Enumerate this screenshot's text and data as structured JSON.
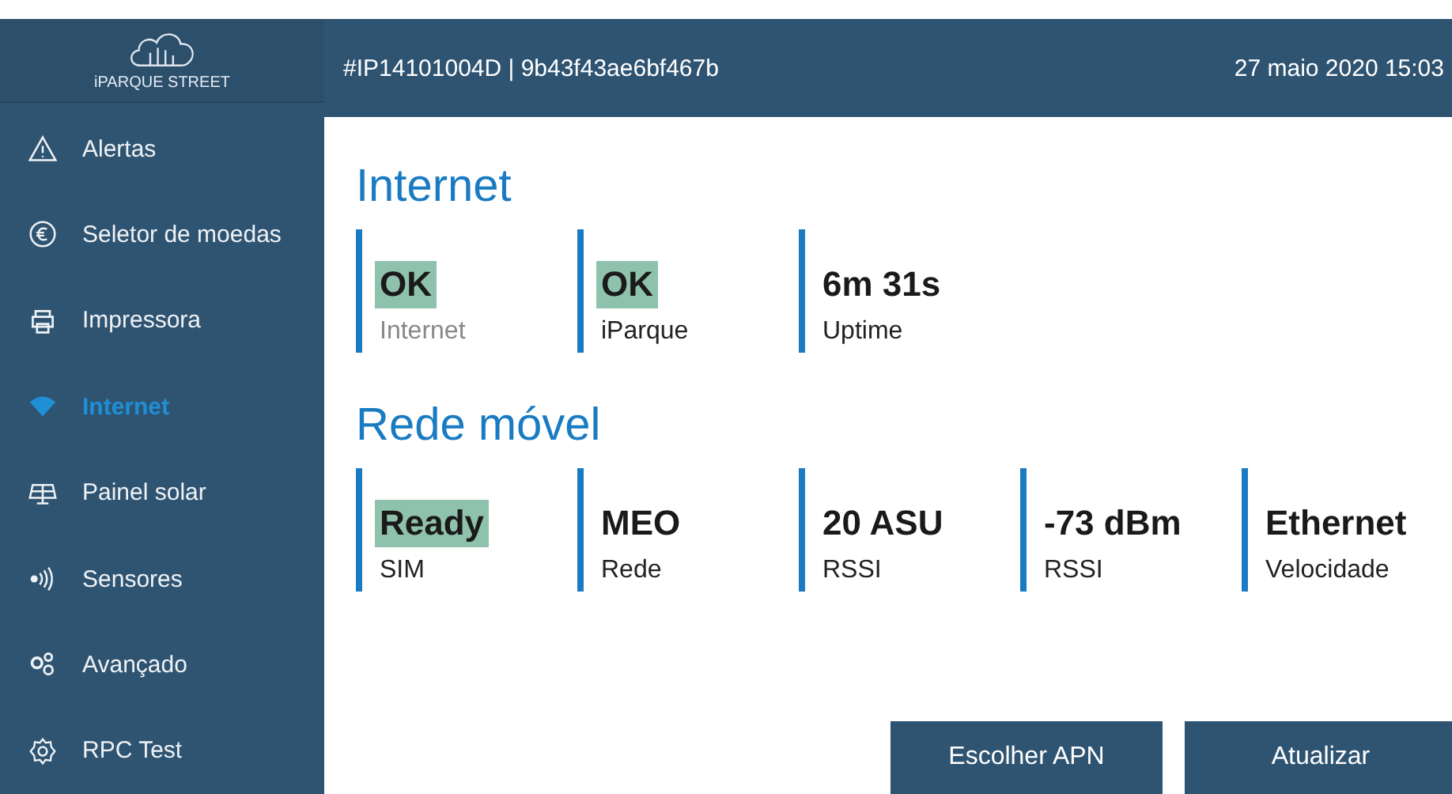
{
  "brand": {
    "name": "iPARQUE STREET"
  },
  "header": {
    "device": "#IP14101004D | 9b43f43ae6bf467b",
    "datetime": "27 maio 2020 15:03"
  },
  "sidebar": {
    "items": [
      {
        "label": "Alertas",
        "kind": "warning",
        "selected": false
      },
      {
        "label": "Seletor de moedas",
        "kind": "euro",
        "selected": false
      },
      {
        "label": "Impressora",
        "kind": "printer",
        "selected": false
      },
      {
        "label": "Internet",
        "kind": "wifi",
        "selected": true
      },
      {
        "label": "Painel solar",
        "kind": "solar",
        "selected": false
      },
      {
        "label": "Sensores",
        "kind": "sensor",
        "selected": false
      },
      {
        "label": "Avançado",
        "kind": "gears",
        "selected": false
      },
      {
        "label": "RPC Test",
        "kind": "gear",
        "selected": false
      }
    ]
  },
  "sections": [
    {
      "title": "Internet",
      "metrics": [
        {
          "value": "OK",
          "label": "Internet",
          "highlighted": true,
          "dimmed": true
        },
        {
          "value": "OK",
          "label": "iParque",
          "highlighted": true,
          "dimmed": false
        },
        {
          "value": "6m 31s",
          "label": "Uptime",
          "highlighted": false,
          "dimmed": false
        }
      ]
    },
    {
      "title": "Rede móvel",
      "metrics": [
        {
          "value": "Ready",
          "label": "SIM",
          "highlighted": true,
          "dimmed": false
        },
        {
          "value": "MEO",
          "label": "Rede",
          "highlighted": false,
          "dimmed": false
        },
        {
          "value": "20 ASU",
          "label": "RSSI",
          "highlighted": false,
          "dimmed": false
        },
        {
          "value": "-73 dBm",
          "label": "RSSI",
          "highlighted": false,
          "dimmed": false
        },
        {
          "value": "Ethernet",
          "label": "Velocidade",
          "highlighted": false,
          "dimmed": false
        }
      ]
    }
  ],
  "buttons": [
    "Escolher APN",
    "Atualizar"
  ]
}
